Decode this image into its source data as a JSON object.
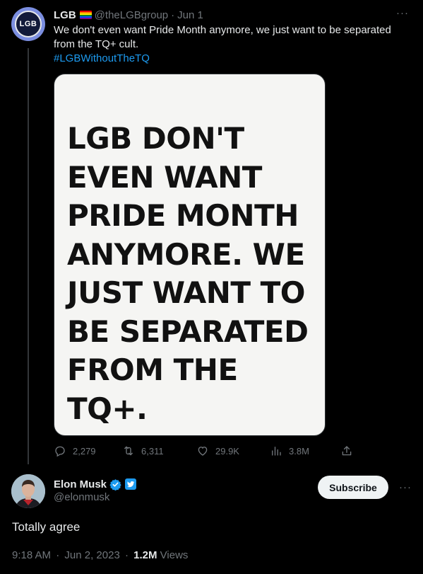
{
  "colors": {
    "background": "#000000",
    "text": "#e7e9ea",
    "muted": "#71767b",
    "link": "#1d9bf0",
    "media_bg": "#f5f5f3"
  },
  "parent_tweet": {
    "avatar_text": "LGB",
    "display_name": "LGB",
    "name_emoji": "rainbow-flag",
    "handle": "@theLGBgroup",
    "separator": "·",
    "date": "Jun 1",
    "more": "···",
    "text": "We don't even want Pride Month anymore, we just want to be separated from the TQ+ cult.",
    "hashtag": "#LGBWithoutTheTQ",
    "media_text": "LGB DON'T\nEVEN WANT\nPRIDE MONTH\nANYMORE. WE\nJUST WANT TO\nBE SEPARATED\nFROM THE TQ+.",
    "actions": {
      "replies": "2,279",
      "retweets": "6,311",
      "likes": "29.9K",
      "views": "3.8M"
    }
  },
  "reply_tweet": {
    "display_name": "Elon Musk",
    "handle": "@elonmusk",
    "subscribe_label": "Subscribe",
    "more": "···",
    "text": "Totally agree",
    "time": "9:18 AM",
    "separator": "·",
    "date": "Jun 2, 2023",
    "meta_separator": "·",
    "views_count": "1.2M",
    "views_label": "Views"
  }
}
